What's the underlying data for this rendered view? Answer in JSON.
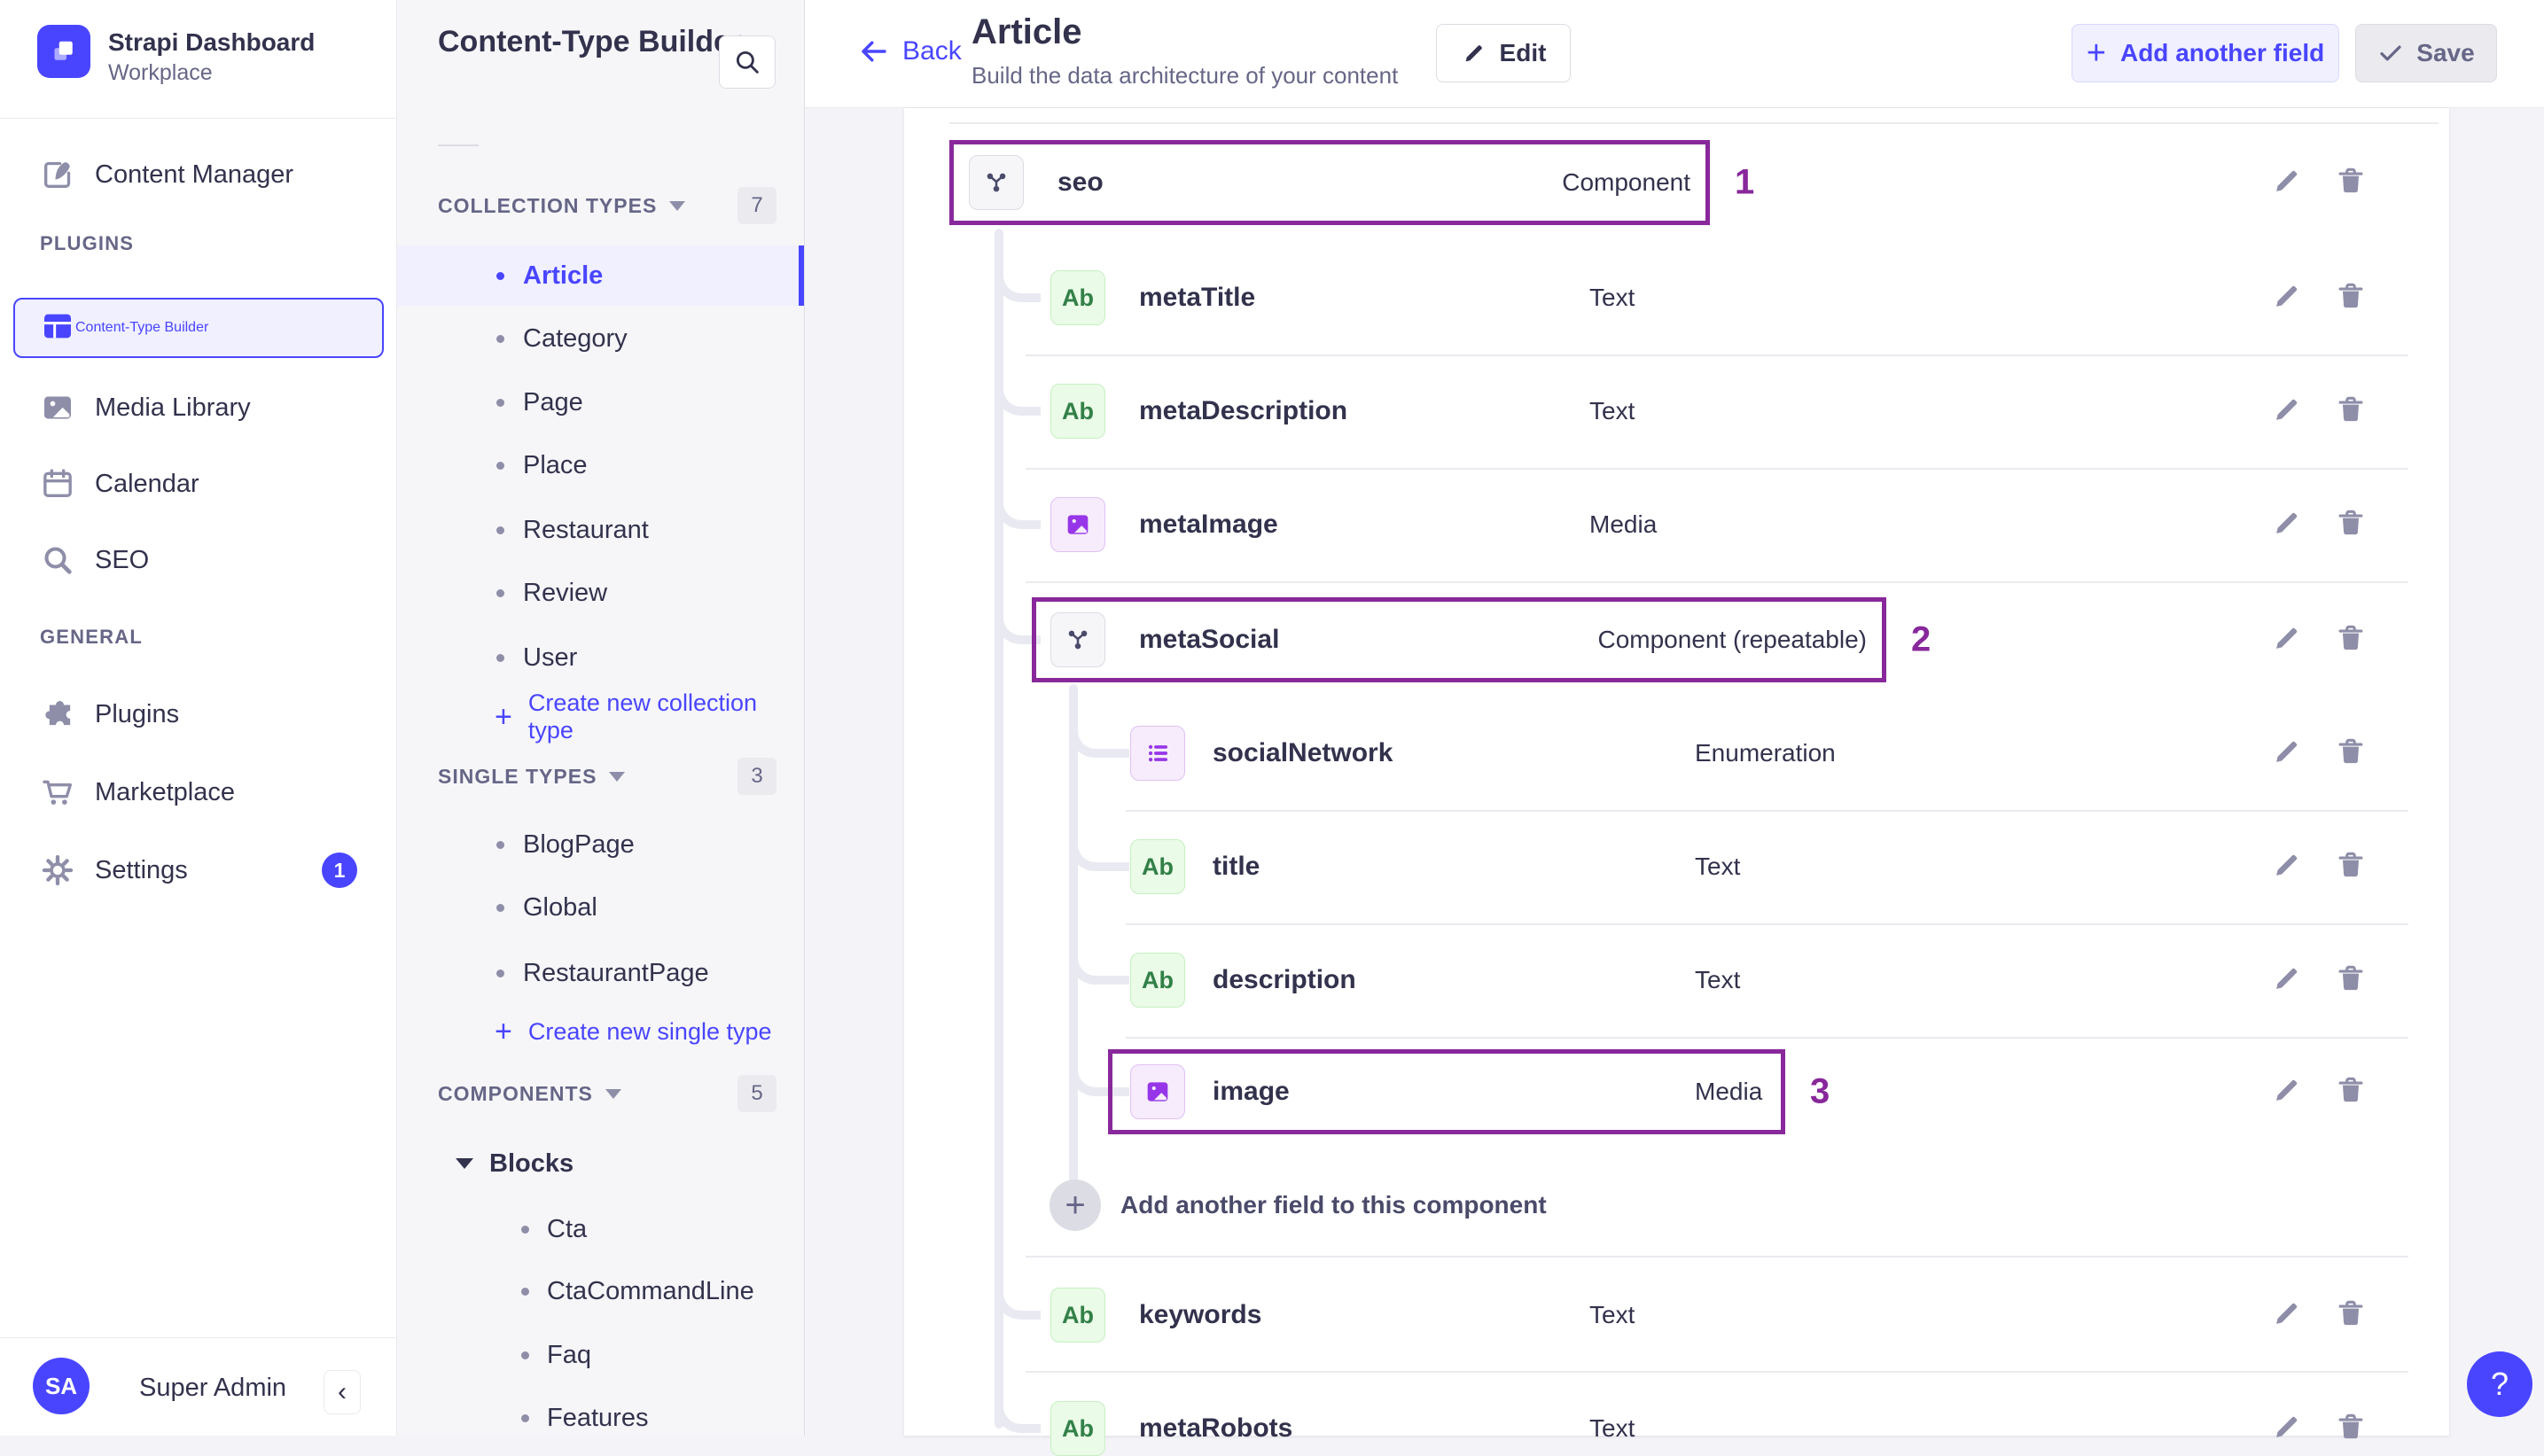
{
  "app": {
    "name": "Strapi Dashboard",
    "workspace": "Workplace",
    "user_initials": "SA",
    "user_name": "Super Admin",
    "collapse_label": "‹",
    "help_label": "?"
  },
  "nav": {
    "content_manager": "Content Manager",
    "sections": [
      {
        "label": "PLUGINS",
        "items": [
          {
            "label": "Content-Type Builder",
            "icon": "layout-icon",
            "active": true
          },
          {
            "label": "Media Library",
            "icon": "image-icon"
          },
          {
            "label": "Calendar",
            "icon": "calendar-icon"
          },
          {
            "label": "SEO",
            "icon": "search-icon"
          }
        ]
      },
      {
        "label": "GENERAL",
        "items": [
          {
            "label": "Plugins",
            "icon": "puzzle-icon"
          },
          {
            "label": "Marketplace",
            "icon": "cart-icon"
          },
          {
            "label": "Settings",
            "icon": "gear-icon",
            "badge": "1"
          }
        ]
      }
    ]
  },
  "subnav": {
    "title": "Content-Type Builder",
    "groups": [
      {
        "label": "COLLECTION TYPES",
        "count": "7",
        "items": [
          {
            "label": "Article",
            "active": true
          },
          {
            "label": "Category"
          },
          {
            "label": "Page"
          },
          {
            "label": "Place"
          },
          {
            "label": "Restaurant"
          },
          {
            "label": "Review"
          },
          {
            "label": "User"
          }
        ],
        "action": "Create new collection type"
      },
      {
        "label": "SINGLE TYPES",
        "count": "3",
        "items": [
          {
            "label": "BlogPage"
          },
          {
            "label": "Global"
          },
          {
            "label": "RestaurantPage"
          }
        ],
        "action": "Create new single type"
      },
      {
        "label": "COMPONENTS",
        "count": "5",
        "tree": {
          "label": "Blocks",
          "children": [
            "Cta",
            "CtaCommandLine",
            "Faq",
            "Features"
          ]
        }
      }
    ]
  },
  "header": {
    "back": "Back",
    "title": "Article",
    "subtitle": "Build the data architecture of your content",
    "edit": "Edit",
    "add_field": "Add another field",
    "save": "Save"
  },
  "fields": [
    {
      "name": "seo",
      "type": "Component",
      "icon": "component",
      "level": 0,
      "annotation": "1"
    },
    {
      "name": "metaTitle",
      "type": "Text",
      "icon": "text",
      "level": 1
    },
    {
      "name": "metaDescription",
      "type": "Text",
      "icon": "text",
      "level": 1
    },
    {
      "name": "metaImage",
      "type": "Media",
      "icon": "media",
      "level": 1
    },
    {
      "name": "metaSocial",
      "type": "Component (repeatable)",
      "icon": "component",
      "level": 1,
      "annotation": "2"
    },
    {
      "name": "socialNetwork",
      "type": "Enumeration",
      "icon": "enumeration",
      "level": 2
    },
    {
      "name": "title",
      "type": "Text",
      "icon": "text",
      "level": 2
    },
    {
      "name": "description",
      "type": "Text",
      "icon": "text",
      "level": 2
    },
    {
      "name": "image",
      "type": "Media",
      "icon": "media",
      "level": 2,
      "annotation": "3"
    },
    {
      "name": "keywords",
      "type": "Text",
      "icon": "text",
      "level": 1
    },
    {
      "name": "metaRobots",
      "type": "Text",
      "icon": "text",
      "level": 1
    }
  ],
  "add_field_row": "Add another field to this component",
  "colors": {
    "accent": "#4945ff",
    "accent_bg": "#f0f0ff",
    "annotation": "#88289b",
    "text_dark": "#32324d",
    "text_muted": "#666687",
    "icon_gray": "#8e8ea9",
    "green_icon": "#328048",
    "purple_icon": "#9736e8",
    "border": "#eaeaef"
  }
}
